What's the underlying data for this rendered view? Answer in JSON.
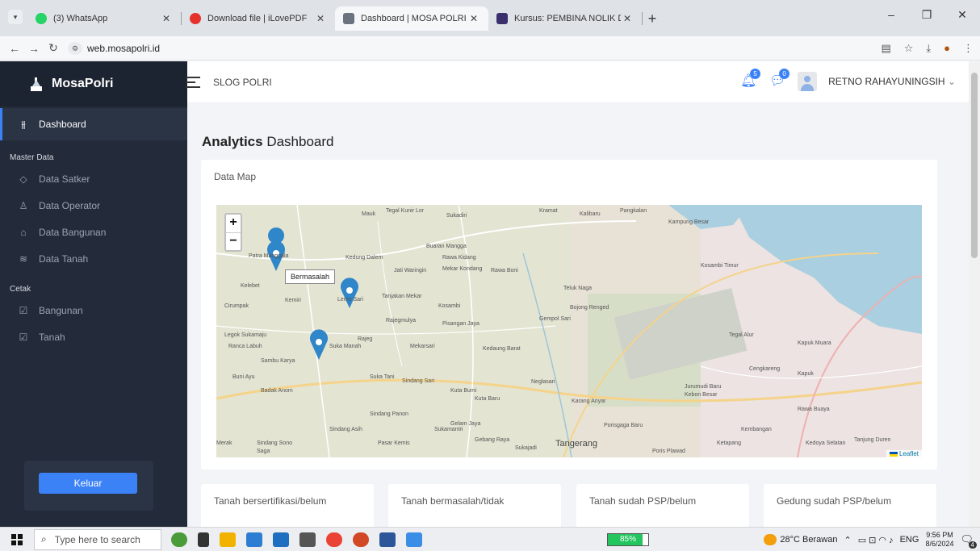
{
  "browser": {
    "tab_menu_icon": "chevron-down",
    "tabs": [
      {
        "title": "(3) WhatsApp",
        "color": "#25d366",
        "active": false
      },
      {
        "title": "Download file | iLovePDF",
        "color": "#e5322d",
        "active": false
      },
      {
        "title": "Dashboard | MOSA POLRI",
        "color": "#6b7280",
        "active": true
      },
      {
        "title": "Kursus: PEMBINA NOLIK DWI A",
        "color": "#3b2f6e",
        "active": false
      }
    ],
    "new_tab_symbol": "+",
    "url": "web.mosapolri.id",
    "window_controls": {
      "minimize": "–",
      "maximize": "❐",
      "close": "✕"
    }
  },
  "sidebar": {
    "brand": "MosaPolri",
    "active_item": {
      "label": "Dashboard",
      "icon": "sliders-icon"
    },
    "sections": [
      {
        "title": "Master Data",
        "items": [
          {
            "label": "Data Satker",
            "icon": "tag-icon"
          },
          {
            "label": "Data Operator",
            "icon": "user-icon"
          },
          {
            "label": "Data Bangunan",
            "icon": "home-icon"
          },
          {
            "label": "Data Tanah",
            "icon": "layers-icon"
          }
        ]
      },
      {
        "title": "Cetak",
        "items": [
          {
            "label": "Bangunan",
            "icon": "edit-icon"
          },
          {
            "label": "Tanah",
            "icon": "edit-icon"
          }
        ]
      }
    ],
    "logout_label": "Keluar"
  },
  "header": {
    "app_title": "SLOG POLRI",
    "notif_count": "5",
    "message_count": "0",
    "username": "RETNO RAHAYUNINGSIH",
    "accent": "#3b82f6"
  },
  "main": {
    "title_bold": "Analytics",
    "title_rest": " Dashboard",
    "map_card_title": "Data Map",
    "map": {
      "zoom_in": "+",
      "zoom_out": "−",
      "tooltip": "Bermasalah",
      "attribution": "Leaflet",
      "labels": [
        "Mauk",
        "Tegal Kunir Lor",
        "Sukadiri",
        "Kramat",
        "Kalibaru",
        "Pangkalan",
        "Kampung Besar",
        "Patra Manggala",
        "Kedung Dalem",
        "Buaran Mangga",
        "Rawa Kidang",
        "Jati Waringin",
        "Mekar Kondang",
        "Rawa Boni",
        "Teluk Naga",
        "Kosambi Timur",
        "Kelebet",
        "Kemiri",
        "Lemo Sari",
        "Tanjakan Mekar",
        "Kosambi",
        "Bojong Renged",
        "Cirumpak",
        "Rajegmulya",
        "Pisangan Jaya",
        "Gempol Sari",
        "Legok Sukamaju",
        "Rajeg",
        "Suka Manah",
        "Mekarsari",
        "Kedaung Barat",
        "Tegal Alur",
        "Ranca Labuh",
        "Sambu Karya",
        "Kapuk Muara",
        "Buni Ayu",
        "Suka Tani",
        "Sindang Sari",
        "Kuta Bumi",
        "Neglasari",
        "Jurumudi Baru",
        "Cengkareng",
        "Kapuk",
        "Badak Anom",
        "Sindang Panon",
        "Kuta Baru",
        "Karang Anyar",
        "Kebon Besar",
        "Rawa Buaya",
        "Sindang Asih",
        "Sukamantri",
        "Gelam Jaya",
        "Porisgaga Baru",
        "Kembangan",
        "Merak",
        "Sindang Sono",
        "Pasar Kemis",
        "Gebang Raya",
        "Tangerang",
        "Ketapang",
        "Kedoya Selatan",
        "Saga",
        "Sukajadi",
        "Poris Plawad",
        "Tanjung Duren"
      ]
    },
    "stat_cards": [
      "Tanah bersertifikasi/belum",
      "Tanah bermasalah/tidak",
      "Tanah sudah PSP/belum",
      "Gedung sudah PSP/belum"
    ]
  },
  "taskbar": {
    "search_placeholder": "Type here to search",
    "battery": "85%",
    "battery_level": 0.85,
    "weather": "28°C Berawan",
    "lang": "ENG",
    "time": "9:56 PM",
    "date": "8/6/2024",
    "notif_count": "4"
  }
}
